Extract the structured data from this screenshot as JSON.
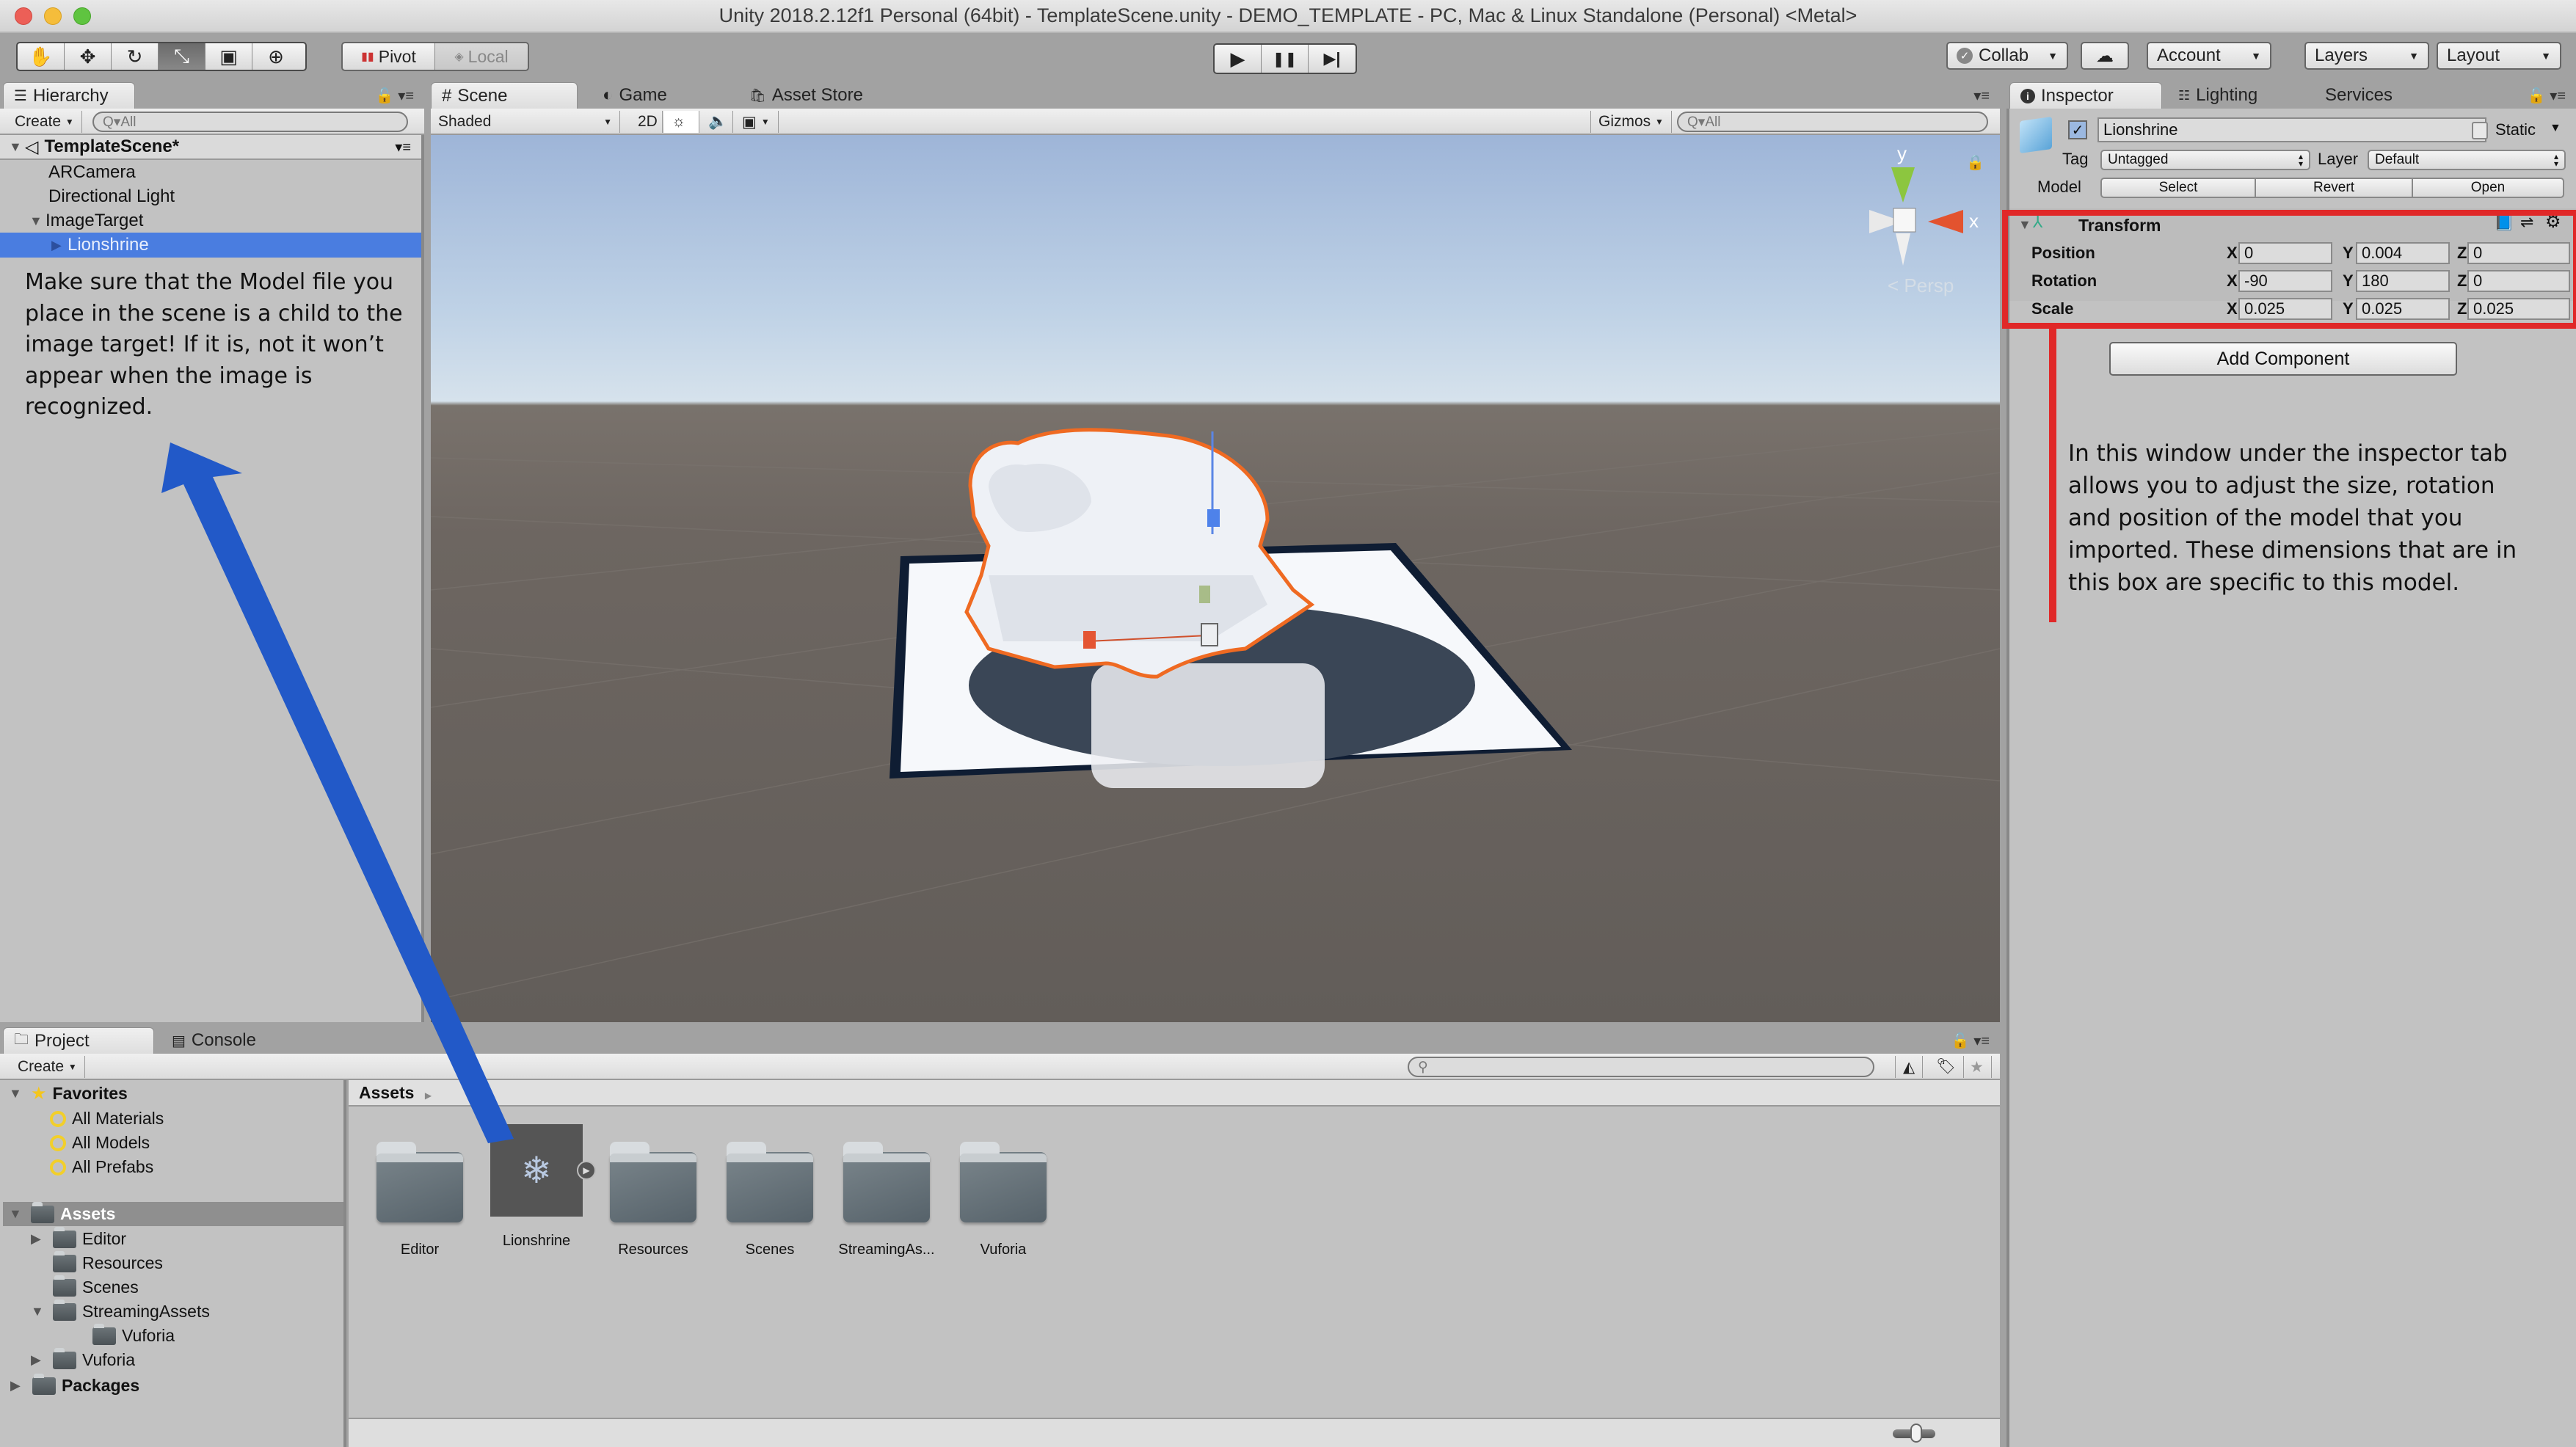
{
  "window": {
    "title": "Unity 2018.2.12f1 Personal (64bit) - TemplateScene.unity - DEMO_TEMPLATE - PC, Mac & Linux Standalone (Personal) <Metal>"
  },
  "toolbar": {
    "tools": [
      {
        "name": "hand-tool",
        "glyph": "✋"
      },
      {
        "name": "move-tool",
        "glyph": "✥"
      },
      {
        "name": "rotate-tool",
        "glyph": "↻"
      },
      {
        "name": "scale-tool",
        "glyph": "⤡"
      },
      {
        "name": "rect-tool",
        "glyph": "▣"
      },
      {
        "name": "transform-tool",
        "glyph": "⊕"
      }
    ],
    "active_tool": "scale-tool",
    "pivot_label": "Pivot",
    "local_label": "Local",
    "play_glyph": "▶",
    "pause_glyph": "❚❚",
    "step_glyph": "▶|",
    "collab_label": "Collab",
    "account_label": "Account",
    "layers_label": "Layers",
    "layout_label": "Layout"
  },
  "hierarchy": {
    "tab_label": "Hierarchy",
    "create_label": "Create",
    "search_placeholder": "Q▾All",
    "scene_name": "TemplateScene*",
    "items": [
      {
        "label": "ARCamera",
        "depth": 1
      },
      {
        "label": "Directional Light",
        "depth": 1
      },
      {
        "label": "ImageTarget",
        "depth": 1,
        "expanded": true
      },
      {
        "label": "Lionshrine",
        "depth": 2,
        "selected": true
      }
    ],
    "annotation": "Make sure that the Model file you place in the scene is a child to the image target! If it is, not it won’t appear when the image is recognized."
  },
  "scene": {
    "tabs": [
      {
        "label": "Scene",
        "icon": "#",
        "active": true
      },
      {
        "label": "Game",
        "icon": "◐",
        "active": false
      },
      {
        "label": "Asset Store",
        "icon": "🛍",
        "active": false
      }
    ],
    "shading_mode": "Shaded",
    "mode_2d_label": "2D",
    "gizmos_label": "Gizmos",
    "search_placeholder": "Q▾All",
    "persp_label": "< Persp",
    "axis_y": "y",
    "axis_x": "x"
  },
  "inspector": {
    "tabs": [
      {
        "label": "Inspector",
        "active": true
      },
      {
        "label": "Lighting",
        "active": false
      },
      {
        "label": "Services",
        "active": false
      }
    ],
    "object_name": "Lionshrine",
    "active_checked": true,
    "static_label": "Static",
    "static_checked": false,
    "tag_label": "Tag",
    "tag_value": "Untagged",
    "layer_label": "Layer",
    "layer_value": "Default",
    "model_label": "Model",
    "model_buttons": [
      "Select",
      "Revert",
      "Open"
    ],
    "transform": {
      "title": "Transform",
      "rows": [
        {
          "label": "Position",
          "x": "0",
          "y": "0.004",
          "z": "0"
        },
        {
          "label": "Rotation",
          "x": "-90",
          "y": "180",
          "z": "0"
        },
        {
          "label": "Scale",
          "x": "0.025",
          "y": "0.025",
          "z": "0.025"
        }
      ]
    },
    "add_component_label": "Add Component",
    "annotation": "In this window under the inspector tab allows you to adjust the size, rotation and position of the model that you imported. These dimensions that are in this box are specific to this model.",
    "highlight_color": "#e02828"
  },
  "project": {
    "tabs": [
      {
        "label": "Project",
        "active": true
      },
      {
        "label": "Console",
        "active": false
      }
    ],
    "create_label": "Create",
    "favorites_label": "Favorites",
    "favorites": [
      "All Materials",
      "All Models",
      "All Prefabs"
    ],
    "assets_label": "Assets",
    "tree": [
      {
        "label": "Editor",
        "depth": 1,
        "arrow": "collapsed"
      },
      {
        "label": "Resources",
        "depth": 1,
        "arrow": "none"
      },
      {
        "label": "Scenes",
        "depth": 1,
        "arrow": "none"
      },
      {
        "label": "StreamingAssets",
        "depth": 1,
        "arrow": "expanded"
      },
      {
        "label": "Vuforia",
        "depth": 2,
        "arrow": "none"
      },
      {
        "label": "Vuforia",
        "depth": 1,
        "arrow": "collapsed"
      }
    ],
    "packages_label": "Packages",
    "breadcrumb": "Assets",
    "grid_items": [
      {
        "label": "Editor",
        "type": "folder"
      },
      {
        "label": "Lionshrine",
        "type": "model"
      },
      {
        "label": "Resources",
        "type": "folder"
      },
      {
        "label": "Scenes",
        "type": "folder"
      },
      {
        "label": "StreamingAs...",
        "type": "folder"
      },
      {
        "label": "Vuforia",
        "type": "folder"
      }
    ],
    "zoom_slider_value": 0.55
  },
  "colors": {
    "selection": "#4a7de0",
    "arrow_annotation": "#2259c8",
    "highlight_box": "#e02828"
  }
}
